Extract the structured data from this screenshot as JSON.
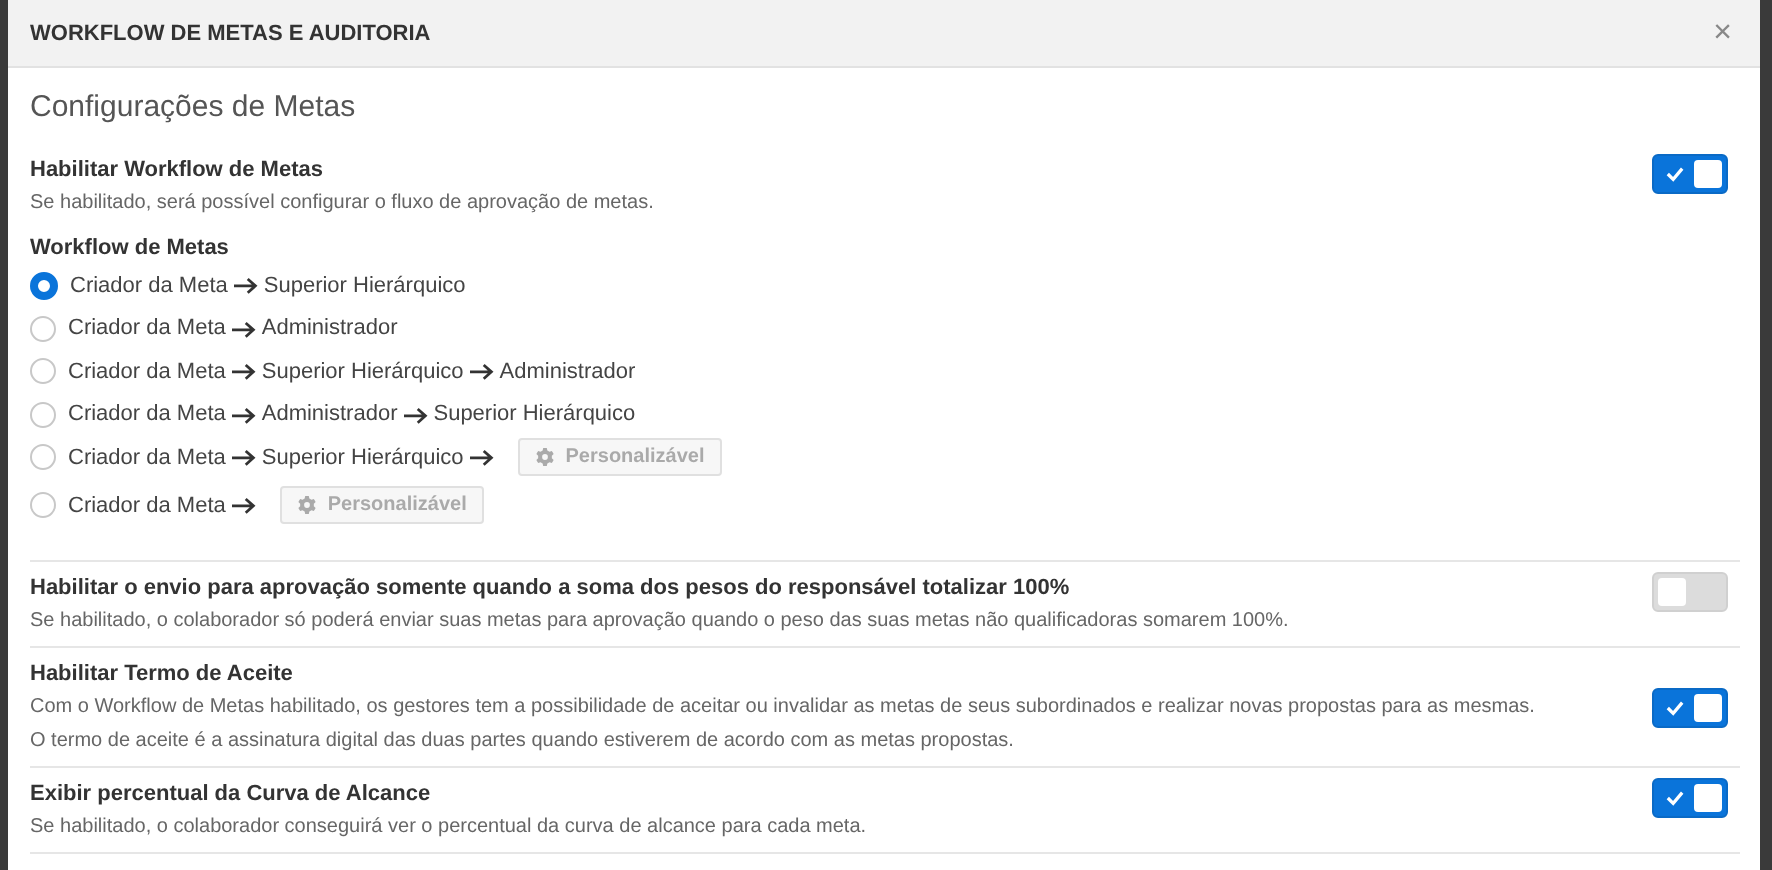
{
  "window": {
    "title": "WORKFLOW DE METAS E AUDITORIA",
    "close": "×"
  },
  "heading": "Configurações de Metas",
  "settings": [
    {
      "title": "Habilitar Workflow de Metas",
      "descriptions": [
        "Se habilitado, será possível configurar o fluxo de aprovação de metas."
      ],
      "on": true,
      "workflow": {
        "label": "Workflow de Metas",
        "options": [
          {
            "selected": true,
            "steps": [
              "Criador da Meta",
              "Superior Hierárquico"
            ]
          },
          {
            "selected": false,
            "steps": [
              "Criador da Meta",
              "Administrador"
            ]
          },
          {
            "selected": false,
            "steps": [
              "Criador da Meta",
              "Superior Hierárquico",
              "Administrador"
            ]
          },
          {
            "selected": false,
            "steps": [
              "Criador da Meta",
              "Administrador",
              "Superior Hierárquico"
            ]
          },
          {
            "selected": false,
            "steps": [
              "Criador da Meta",
              "Superior Hierárquico"
            ],
            "custom": "Personalizável"
          },
          {
            "selected": false,
            "steps": [
              "Criador da Meta"
            ],
            "custom": "Personalizável"
          }
        ]
      }
    },
    {
      "title": "Habilitar o envio para aprovação somente quando a soma dos pesos do responsável totalizar 100%",
      "descriptions": [
        "Se habilitado, o colaborador só poderá enviar suas metas para aprovação quando o peso das suas metas não qualificadoras somarem 100%."
      ],
      "on": false
    },
    {
      "title": "Habilitar Termo de Aceite",
      "descriptions": [
        "Com o Workflow de Metas habilitado, os gestores tem a possibilidade de aceitar ou invalidar as metas de seus subordinados e realizar novas propostas para as mesmas.",
        "O termo de aceite é a assinatura digital das duas partes quando estiverem de acordo com as metas propostas."
      ],
      "on": true
    },
    {
      "title": "Exibir percentual da Curva de Alcance",
      "descriptions": [
        "Se habilitado, o colaborador conseguirá ver o percentual da curva de alcance para cada meta."
      ],
      "on": true
    }
  ]
}
